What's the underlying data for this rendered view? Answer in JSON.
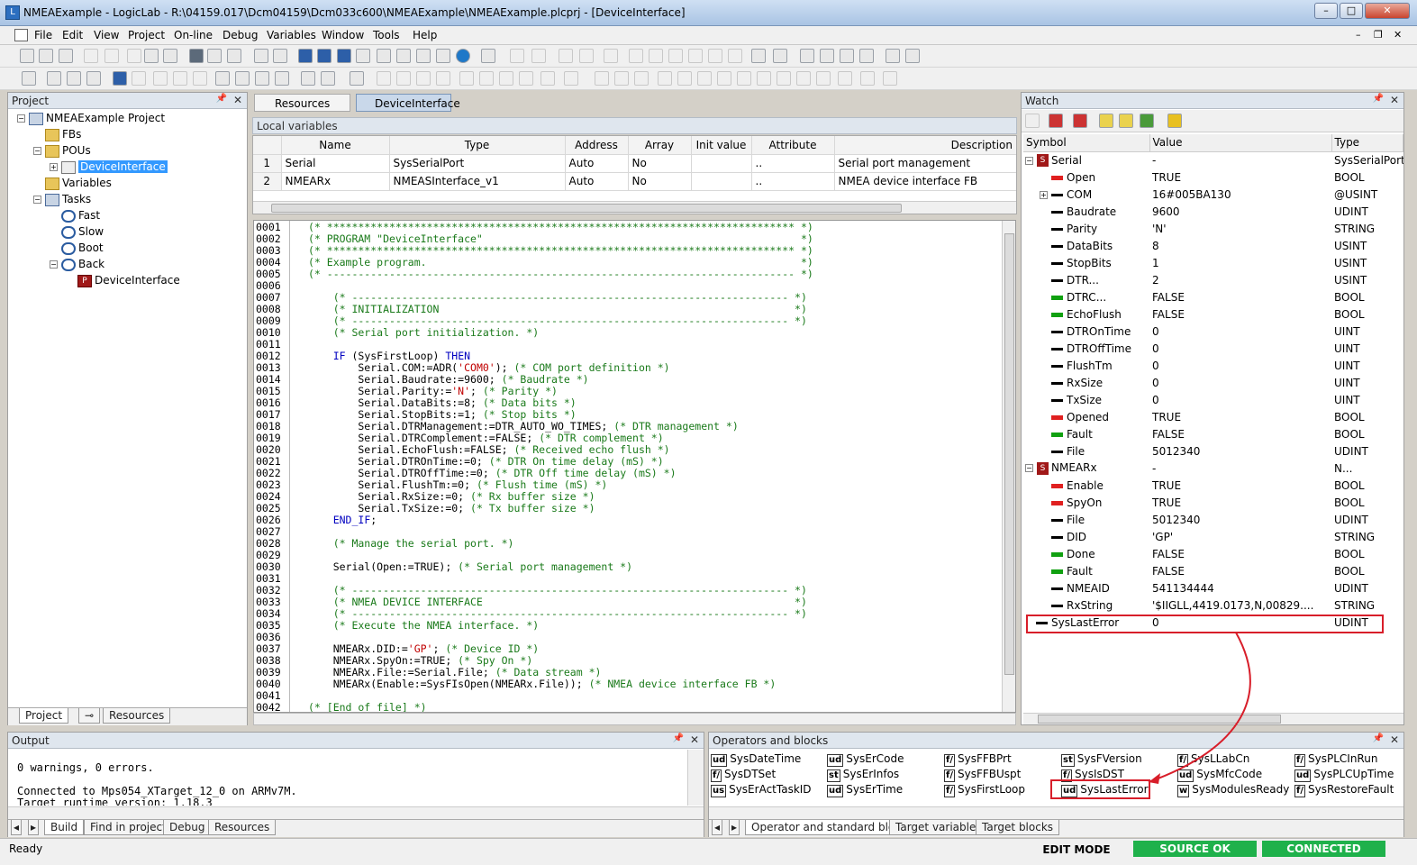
{
  "window": {
    "title": "NMEAExample - LogicLab - R:\\04159.017\\Dcm04159\\Dcm033c600\\NMEAExample\\NMEAExample.plcprj - [DeviceInterface]",
    "app_icon": "logiclab-app-icon",
    "controls": [
      "–",
      "□",
      "✕"
    ],
    "mdi_controls": [
      "–",
      "❐",
      "✕"
    ]
  },
  "menu": [
    "File",
    "Edit",
    "View",
    "Project",
    "On-line",
    "Debug",
    "Variables",
    "Window",
    "Tools",
    "Help"
  ],
  "project_panel": {
    "title": "Project",
    "tree": [
      {
        "label": "NMEAExample Project",
        "level": 0,
        "icon": "project-icon",
        "expander": "−"
      },
      {
        "label": "FBs",
        "level": 1,
        "icon": "folder-icon"
      },
      {
        "label": "POUs",
        "level": 1,
        "icon": "folder-icon",
        "expander": "−"
      },
      {
        "label": "DeviceInterface",
        "level": 2,
        "icon": "pou-icon",
        "expander": "+",
        "selected": true
      },
      {
        "label": "Variables",
        "level": 1,
        "icon": "folder-icon"
      },
      {
        "label": "Tasks",
        "level": 1,
        "icon": "tasks-icon",
        "expander": "−"
      },
      {
        "label": "Fast",
        "level": 2,
        "icon": "task-icon"
      },
      {
        "label": "Slow",
        "level": 2,
        "icon": "task-icon"
      },
      {
        "label": "Boot",
        "level": 2,
        "icon": "task-icon"
      },
      {
        "label": "Back",
        "level": 2,
        "icon": "task-icon",
        "expander": "−"
      },
      {
        "label": "DeviceInterface",
        "level": 3,
        "icon": "program-icon"
      }
    ],
    "bottom_tabs": [
      "Project",
      "Resources"
    ]
  },
  "editor": {
    "tabs": [
      "Resources",
      "DeviceInterface"
    ],
    "local_variables_label": "Local variables",
    "columns": [
      "",
      "Name",
      "Type",
      "Address",
      "Array",
      "Init value",
      "Attribute",
      "Description"
    ],
    "rows": [
      [
        "1",
        "Serial",
        "SysSerialPort",
        "Auto",
        "No",
        "",
        "..",
        "Serial port management"
      ],
      [
        "2",
        "NMEARx",
        "NMEASInterface_v1",
        "Auto",
        "No",
        "",
        "..",
        "NMEA device interface FB"
      ]
    ],
    "code": [
      [
        "c",
        "(* *************************************************************************** *)"
      ],
      [
        "c",
        "(* PROGRAM \"DeviceInterface\"                                                   *)"
      ],
      [
        "c",
        "(* *************************************************************************** *)"
      ],
      [
        "c",
        "(* Example program.                                                            *)"
      ],
      [
        "c",
        "(* --------------------------------------------------------------------------- *)"
      ],
      [
        "n",
        ""
      ],
      [
        "c",
        "    (* ---------------------------------------------------------------------- *)"
      ],
      [
        "c",
        "    (* INITIALIZATION                                                         *)"
      ],
      [
        "c",
        "    (* ---------------------------------------------------------------------- *)"
      ],
      [
        "c",
        "    (* Serial port initialization. *)"
      ],
      [
        "n",
        ""
      ],
      [
        "n",
        "    IF (SysFirstLoop) THEN"
      ],
      [
        "n",
        "        Serial.COM:=ADR('COM0'); (* COM port definition *)"
      ],
      [
        "n",
        "        Serial.Baudrate:=9600; (* Baudrate *)"
      ],
      [
        "n",
        "        Serial.Parity:='N'; (* Parity *)"
      ],
      [
        "n",
        "        Serial.DataBits:=8; (* Data bits *)"
      ],
      [
        "n",
        "        Serial.StopBits:=1; (* Stop bits *)"
      ],
      [
        "n",
        "        Serial.DTRManagement:=DTR_AUTO_WO_TIMES; (* DTR management *)"
      ],
      [
        "n",
        "        Serial.DTRComplement:=FALSE; (* DTR complement *)"
      ],
      [
        "n",
        "        Serial.EchoFlush:=FALSE; (* Received echo flush *)"
      ],
      [
        "n",
        "        Serial.DTROnTime:=0; (* DTR On time delay (mS) *)"
      ],
      [
        "n",
        "        Serial.DTROffTime:=0; (* DTR Off time delay (mS) *)"
      ],
      [
        "n",
        "        Serial.FlushTm:=0; (* Flush time (mS) *)"
      ],
      [
        "n",
        "        Serial.RxSize:=0; (* Rx buffer size *)"
      ],
      [
        "n",
        "        Serial.TxSize:=0; (* Tx buffer size *)"
      ],
      [
        "n",
        "    END_IF;"
      ],
      [
        "n",
        ""
      ],
      [
        "c",
        "    (* Manage the serial port. *)"
      ],
      [
        "n",
        ""
      ],
      [
        "n",
        "    Serial(Open:=TRUE); (* Serial port management *)"
      ],
      [
        "n",
        ""
      ],
      [
        "c",
        "    (* ---------------------------------------------------------------------- *)"
      ],
      [
        "c",
        "    (* NMEA DEVICE INTERFACE                                                  *)"
      ],
      [
        "c",
        "    (* ---------------------------------------------------------------------- *)"
      ],
      [
        "c",
        "    (* Execute the NMEA interface. *)"
      ],
      [
        "n",
        ""
      ],
      [
        "n",
        "    NMEARx.DID:='GP'; (* Device ID *)"
      ],
      [
        "n",
        "    NMEARx.SpyOn:=TRUE; (* Spy On *)"
      ],
      [
        "n",
        "    NMEARx.File:=Serial.File; (* Data stream *)"
      ],
      [
        "n",
        "    NMEARx(Enable:=SysFIsOpen(NMEARx.File)); (* NMEA device interface FB *)"
      ],
      [
        "n",
        ""
      ],
      [
        "c",
        "(* [End of file] *)"
      ]
    ],
    "line_numbers": [
      "0001",
      "0002",
      "0003",
      "0004",
      "0005",
      "0006",
      "0007",
      "0008",
      "0009",
      "0010",
      "0011",
      "0012",
      "0013",
      "0014",
      "0015",
      "0016",
      "0017",
      "0018",
      "0019",
      "0020",
      "0021",
      "0022",
      "0023",
      "0024",
      "0025",
      "0026",
      "0027",
      "0028",
      "0029",
      "0030",
      "0031",
      "0032",
      "0033",
      "0034",
      "0035",
      "0036",
      "0037",
      "0038",
      "0039",
      "0040",
      "0041",
      "0042"
    ]
  },
  "watch": {
    "title": "Watch",
    "columns": [
      "Symbol",
      "Value",
      "Type"
    ],
    "rows": [
      {
        "indent": 0,
        "exp": "−",
        "mark": "struct",
        "symbol": "Serial",
        "value": "-",
        "type": "SysSerialPort"
      },
      {
        "indent": 1,
        "mark": "r",
        "symbol": "Open",
        "value": "TRUE",
        "type": "BOOL"
      },
      {
        "indent": 1,
        "exp": "+",
        "mark": "k",
        "symbol": "COM",
        "value": "16#005BA130",
        "type": "@USINT"
      },
      {
        "indent": 1,
        "mark": "k",
        "symbol": "Baudrate",
        "value": "9600",
        "type": "UDINT"
      },
      {
        "indent": 1,
        "mark": "k",
        "symbol": "Parity",
        "value": "'N'",
        "type": "STRING"
      },
      {
        "indent": 1,
        "mark": "k",
        "symbol": "DataBits",
        "value": "8",
        "type": "USINT"
      },
      {
        "indent": 1,
        "mark": "k",
        "symbol": "StopBits",
        "value": "1",
        "type": "USINT"
      },
      {
        "indent": 1,
        "mark": "k",
        "symbol": "DTR...",
        "value": "2",
        "type": "USINT"
      },
      {
        "indent": 1,
        "mark": "g",
        "symbol": "DTRC...",
        "value": "FALSE",
        "type": "BOOL"
      },
      {
        "indent": 1,
        "mark": "g",
        "symbol": "EchoFlush",
        "value": "FALSE",
        "type": "BOOL"
      },
      {
        "indent": 1,
        "mark": "k",
        "symbol": "DTROnTime",
        "value": "0",
        "type": "UINT"
      },
      {
        "indent": 1,
        "mark": "k",
        "symbol": "DTROffTime",
        "value": "0",
        "type": "UINT"
      },
      {
        "indent": 1,
        "mark": "k",
        "symbol": "FlushTm",
        "value": "0",
        "type": "UINT"
      },
      {
        "indent": 1,
        "mark": "k",
        "symbol": "RxSize",
        "value": "0",
        "type": "UINT"
      },
      {
        "indent": 1,
        "mark": "k",
        "symbol": "TxSize",
        "value": "0",
        "type": "UINT"
      },
      {
        "indent": 1,
        "mark": "r",
        "symbol": "Opened",
        "value": "TRUE",
        "type": "BOOL"
      },
      {
        "indent": 1,
        "mark": "g",
        "symbol": "Fault",
        "value": "FALSE",
        "type": "BOOL"
      },
      {
        "indent": 1,
        "mark": "k",
        "symbol": "File",
        "value": "5012340",
        "type": "UDINT"
      },
      {
        "indent": 0,
        "exp": "−",
        "mark": "struct",
        "symbol": "NMEARx",
        "value": "-",
        "type": "N..."
      },
      {
        "indent": 1,
        "mark": "r",
        "symbol": "Enable",
        "value": "TRUE",
        "type": "BOOL"
      },
      {
        "indent": 1,
        "mark": "r",
        "symbol": "SpyOn",
        "value": "TRUE",
        "type": "BOOL"
      },
      {
        "indent": 1,
        "mark": "k",
        "symbol": "File",
        "value": "5012340",
        "type": "UDINT"
      },
      {
        "indent": 1,
        "mark": "k",
        "symbol": "DID",
        "value": "'GP'",
        "type": "STRING"
      },
      {
        "indent": 1,
        "mark": "g",
        "symbol": "Done",
        "value": "FALSE",
        "type": "BOOL"
      },
      {
        "indent": 1,
        "mark": "g",
        "symbol": "Fault",
        "value": "FALSE",
        "type": "BOOL"
      },
      {
        "indent": 1,
        "mark": "k",
        "symbol": "NMEAID",
        "value": "541134444",
        "type": "UDINT"
      },
      {
        "indent": 1,
        "mark": "k",
        "symbol": "RxString",
        "value": "'$IIGLL,4419.0173,N,00829....",
        "type": "STRING"
      },
      {
        "indent": 0,
        "mark": "k",
        "symbol": "SysLastError",
        "value": "0",
        "type": "UDINT",
        "highlight": true
      }
    ]
  },
  "output": {
    "title": "Output",
    "lines": [
      "0 warnings, 0 errors.",
      "",
      "Connected to Mps054_XTarget_12_0 on ARMv7M.",
      "Target runtime version: 1.18.3"
    ],
    "tabs": [
      "Build",
      "Find in project",
      "Debug",
      "Resources"
    ]
  },
  "operators": {
    "title": "Operators and blocks",
    "items": [
      [
        "ud",
        "SysDateTime"
      ],
      [
        "ud",
        "SysErCode"
      ],
      [
        "f/",
        "SysFFBPrt"
      ],
      [
        "st",
        "SysFVersion"
      ],
      [
        "f/",
        "SysLLabCn"
      ],
      [
        "f/",
        "SysPLCInRun"
      ],
      [
        "f/",
        "SysDTSet"
      ],
      [
        "st",
        "SysErInfos"
      ],
      [
        "f/",
        "SysFFBUspt"
      ],
      [
        "f/",
        "SysIsDST"
      ],
      [
        "ud",
        "SysMfcCode"
      ],
      [
        "ud",
        "SysPLCUpTime"
      ],
      [
        "us",
        "SysErActTaskID"
      ],
      [
        "ud",
        "SysErTime"
      ],
      [
        "f/",
        "SysFirstLoop"
      ],
      [
        "ud",
        "SysLastError"
      ],
      [
        "w",
        "SysModulesReady"
      ],
      [
        "f/",
        "SysRestoreFault"
      ]
    ],
    "tabs": [
      "Operator and standard blocks",
      "Target variables",
      "Target blocks"
    ]
  },
  "status": {
    "left": "Ready",
    "mode": "EDIT MODE",
    "source": "SOURCE OK",
    "connection": "CONNECTED",
    "ok_color": "#1fb14b"
  },
  "annotation_color": "#d81e2a"
}
